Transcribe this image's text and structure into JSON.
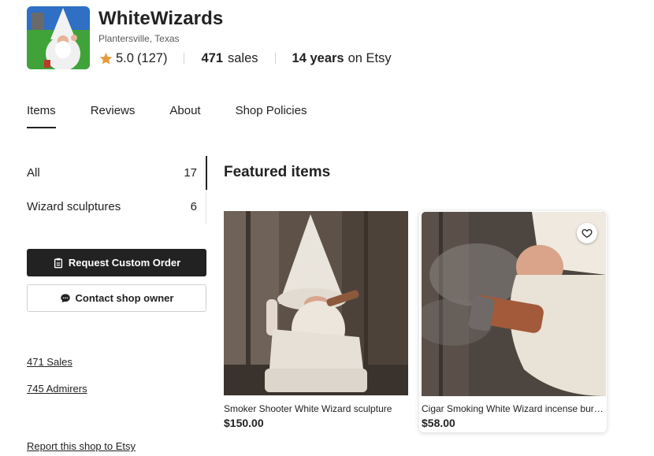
{
  "shop": {
    "name": "WhiteWizards",
    "location": "Plantersville, Texas",
    "rating": "5.0",
    "review_count": "(127)",
    "sales_count": "471",
    "sales_label": "sales",
    "years": "14 years",
    "years_suffix": "on Etsy"
  },
  "tabs": [
    {
      "label": "Items",
      "active": true
    },
    {
      "label": "Reviews"
    },
    {
      "label": "About"
    },
    {
      "label": "Shop Policies"
    }
  ],
  "sidebar": {
    "sections": [
      {
        "label": "All",
        "count": "17"
      },
      {
        "label": "Wizard sculptures",
        "count": "6"
      }
    ],
    "request_custom_order": "Request Custom Order",
    "contact_owner": "Contact shop owner",
    "sales_link": "471 Sales",
    "admirers_link": "745 Admirers",
    "report_link": "Report this shop to Etsy"
  },
  "featured": {
    "heading": "Featured items",
    "items": [
      {
        "title": "Smoker Shooter White Wizard sculpture",
        "price": "$150.00"
      },
      {
        "title": "Cigar Smoking White Wizard incense burner",
        "price": "$58.00"
      }
    ]
  },
  "colors": {
    "star": "#e59b3a",
    "text": "#222222",
    "button_dark": "#222222"
  }
}
